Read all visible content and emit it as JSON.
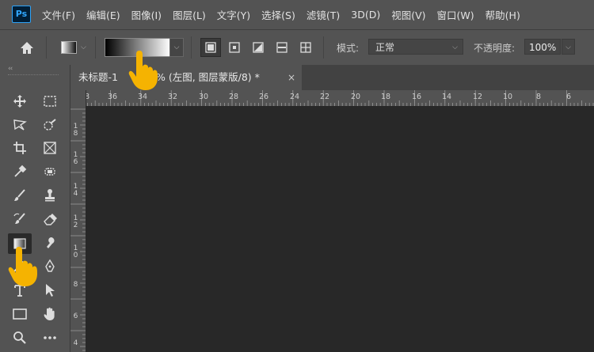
{
  "app": {
    "logo_text": "Ps"
  },
  "menu": [
    "文件(F)",
    "编辑(E)",
    "图像(I)",
    "图层(L)",
    "文字(Y)",
    "选择(S)",
    "滤镜(T)",
    "3D(D)",
    "视图(V)",
    "窗口(W)",
    "帮助(H)"
  ],
  "options": {
    "mode_label": "模式:",
    "mode_value": "正常",
    "opacity_label": "不透明度:",
    "opacity_value": "100%"
  },
  "document_tab": {
    "title": "未标题-1",
    "suffix": "% (左图, 图层蒙版/8) *",
    "close": "×"
  },
  "ruler": {
    "top_labels": [
      "8",
      "36",
      "34",
      "32",
      "30",
      "28",
      "26",
      "24",
      "22",
      "20",
      "18",
      "16",
      "14",
      "12",
      "10",
      "8",
      "6"
    ],
    "left_labels": [
      [
        "1",
        "8"
      ],
      [
        "1",
        "6"
      ],
      [
        "1",
        "4"
      ],
      [
        "1",
        "2"
      ],
      [
        "1",
        "0"
      ],
      [
        "8"
      ],
      [
        "6"
      ],
      [
        "4"
      ]
    ]
  },
  "toolbar": {
    "collapse_glyph": "‹‹",
    "tools": [
      {
        "name": "move-tool",
        "active": false
      },
      {
        "name": "marquee-tool",
        "active": false
      },
      {
        "name": "lasso-tool",
        "active": false
      },
      {
        "name": "quick-selection-tool",
        "active": false
      },
      {
        "name": "crop-tool",
        "active": false
      },
      {
        "name": "frame-tool",
        "active": false
      },
      {
        "name": "eyedropper-tool",
        "active": false
      },
      {
        "name": "spot-healing-tool",
        "active": false
      },
      {
        "name": "brush-tool",
        "active": false
      },
      {
        "name": "clone-stamp-tool",
        "active": false
      },
      {
        "name": "history-brush-tool",
        "active": false
      },
      {
        "name": "eraser-tool",
        "active": false
      },
      {
        "name": "gradient-tool",
        "active": true
      },
      {
        "name": "smudge-tool",
        "active": false
      },
      {
        "name": "dodge-tool",
        "active": false
      },
      {
        "name": "pen-tool",
        "active": false
      },
      {
        "name": "type-tool",
        "active": false
      },
      {
        "name": "path-selection-tool",
        "active": false
      },
      {
        "name": "rectangle-tool",
        "active": false
      },
      {
        "name": "hand-tool",
        "active": false
      },
      {
        "name": "zoom-tool",
        "active": false
      },
      {
        "name": "more-tools",
        "active": false
      }
    ]
  },
  "colors": {
    "ui_bg": "#535353",
    "canvas_bg": "#282828",
    "pointer_hand": "#f5b301"
  }
}
